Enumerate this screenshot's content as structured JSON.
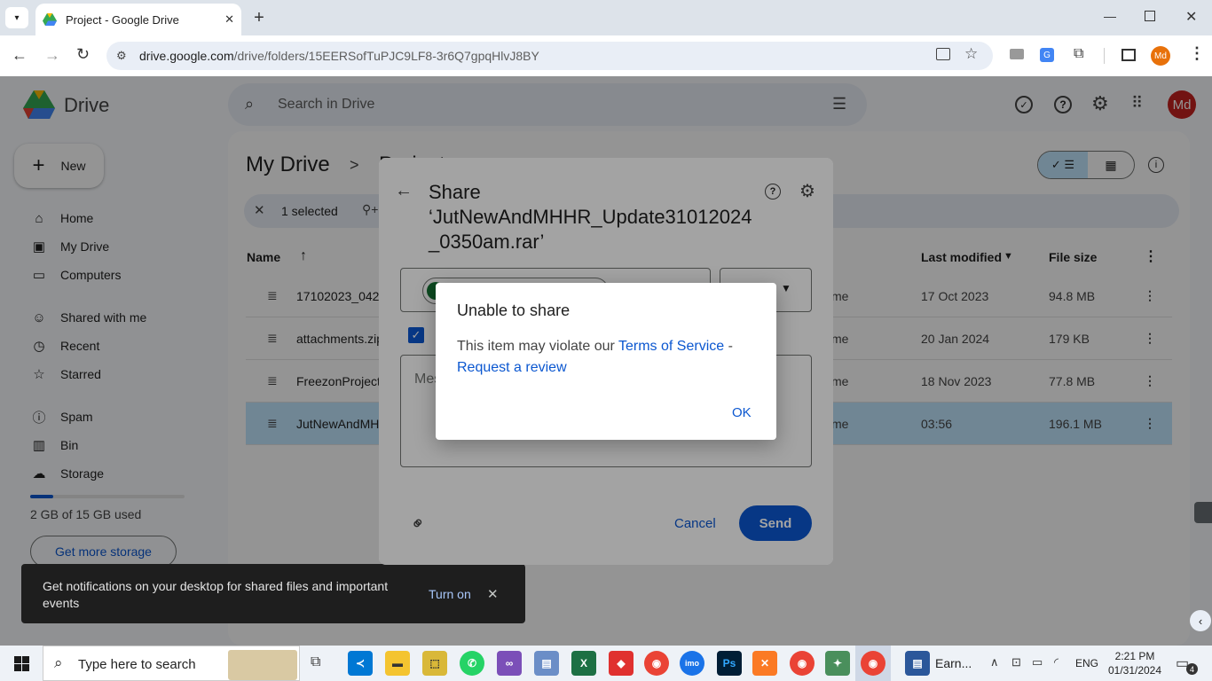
{
  "browser": {
    "tab_title": "Project - Google Drive",
    "url_host": "drive.google.com",
    "url_path": "/drive/folders/15EERSofTuPJC9LF8-3r6Q7gpqHlvJ8BY",
    "profile": "Md"
  },
  "drive": {
    "app_name": "Drive",
    "search_placeholder": "Search in Drive",
    "new_label": "New",
    "nav": [
      {
        "label": "Home"
      },
      {
        "label": "My Drive"
      },
      {
        "label": "Computers"
      },
      {
        "label": "Shared with me"
      },
      {
        "label": "Recent"
      },
      {
        "label": "Starred"
      },
      {
        "label": "Spam"
      },
      {
        "label": "Bin"
      },
      {
        "label": "Storage"
      }
    ],
    "storage_text": "2 GB of 15 GB used",
    "storage_fraction": 0.15,
    "get_storage_label": "Get more storage",
    "breadcrumb_root": "My Drive",
    "breadcrumb_sep": ">",
    "breadcrumb_current": "Project",
    "selected_text": "1 selected",
    "columns": {
      "name": "Name",
      "last_modified": "Last modified",
      "file_size": "File size"
    },
    "files": [
      {
        "name": "17102023_0428",
        "owner": "me",
        "modified": "17 Oct 2023",
        "size": "94.8 MB"
      },
      {
        "name": "attachments.zip",
        "owner": "me",
        "modified": "20 Jan 2024",
        "size": "179 KB"
      },
      {
        "name": "FreezonProject",
        "owner": "me",
        "modified": "18 Nov 2023",
        "size": "77.8 MB"
      },
      {
        "name": "JutNewAndMHHR",
        "owner": "me",
        "modified": "03:56",
        "size": "196.1 MB"
      }
    ],
    "user_initials": "Md"
  },
  "share_dialog": {
    "title_line1": "Share",
    "title_line2": "‘JutNewAndMHHR_Update31012024",
    "title_line3": "_0350am.rar’",
    "message_placeholder": "Message",
    "cancel_label": "Cancel",
    "send_label": "Send"
  },
  "alert": {
    "title": "Unable to share",
    "body_prefix": "This item may violate our ",
    "tos_link": "Terms of Service",
    "dash": " -",
    "review_link": "Request a review",
    "ok_label": "OK"
  },
  "snackbar": {
    "text": "Get notifications on your desktop for shared files and important events",
    "action": "Turn on"
  },
  "taskbar": {
    "search_placeholder": "Type here to search",
    "word_label": "Earn...",
    "language": "ENG",
    "time": "2:21 PM",
    "date": "01/31/2024",
    "notification_count": "4"
  },
  "colors": {
    "accent": "#0b57d0",
    "selected_row": "#c2e7ff",
    "avatar": "#c5221f"
  }
}
